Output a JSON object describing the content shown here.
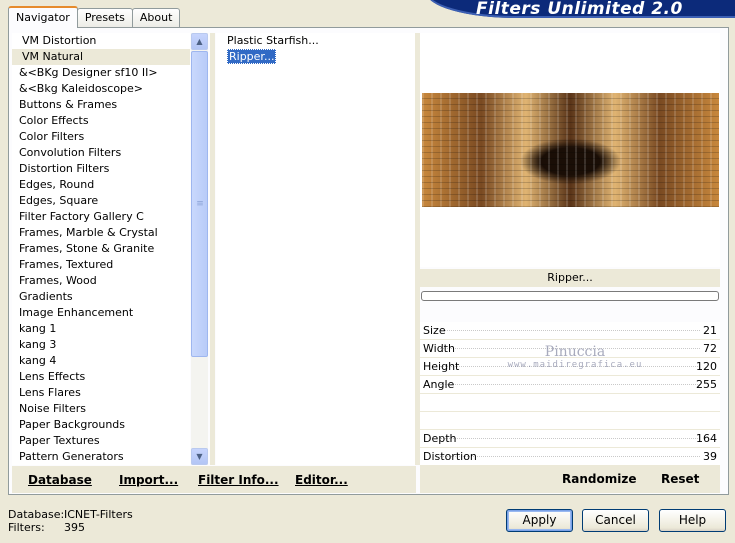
{
  "banner": {
    "title": "Filters Unlimited 2.0"
  },
  "tabs": [
    {
      "label": "Navigator",
      "active": true
    },
    {
      "label": "Presets",
      "active": false
    },
    {
      "label": "About",
      "active": false
    }
  ],
  "categories": [
    "VM Distortion",
    "VM Natural",
    "&<BKg Designer sf10 II>",
    "&<Bkg Kaleidoscope>",
    "Buttons & Frames",
    "Color Effects",
    "Color Filters",
    "Convolution Filters",
    "Distortion Filters",
    "Edges, Round",
    "Edges, Square",
    "Filter Factory Gallery C",
    "Frames, Marble & Crystal",
    "Frames, Stone & Granite",
    "Frames, Textured",
    "Frames, Wood",
    "Gradients",
    "Image Enhancement",
    "kang 1",
    "kang 3",
    "kang 4",
    "Lens Effects",
    "Lens Flares",
    "Noise Filters",
    "Paper Backgrounds",
    "Paper Textures",
    "Pattern Generators"
  ],
  "selected_category": "VM Natural",
  "filters": [
    {
      "label": "Plastic Starfish...",
      "selected": false
    },
    {
      "label": "Ripper...",
      "selected": true
    }
  ],
  "preview": {
    "filter_name": "Ripper..."
  },
  "params": [
    {
      "name": "Size",
      "value": "21"
    },
    {
      "name": "Width",
      "value": "72"
    },
    {
      "name": "Height",
      "value": "120"
    },
    {
      "name": "Angle",
      "value": "255"
    },
    {
      "name": "",
      "value": ""
    },
    {
      "name": "",
      "value": ""
    },
    {
      "name": "Depth",
      "value": "164"
    },
    {
      "name": "Distortion",
      "value": "39"
    }
  ],
  "watermark": {
    "name": "Pinuccia",
    "url": "www.maidiregrafica.eu"
  },
  "left_actions": {
    "database": "Database",
    "import": "Import...",
    "filter_info": "Filter Info...",
    "editor": "Editor..."
  },
  "right_actions": {
    "randomize": "Randomize",
    "reset": "Reset"
  },
  "footer": {
    "database_label": "Database:",
    "database_value": "ICNET-Filters",
    "filters_label": "Filters:",
    "filters_value": "395"
  },
  "buttons": {
    "apply": "Apply",
    "cancel": "Cancel",
    "help": "Help"
  }
}
